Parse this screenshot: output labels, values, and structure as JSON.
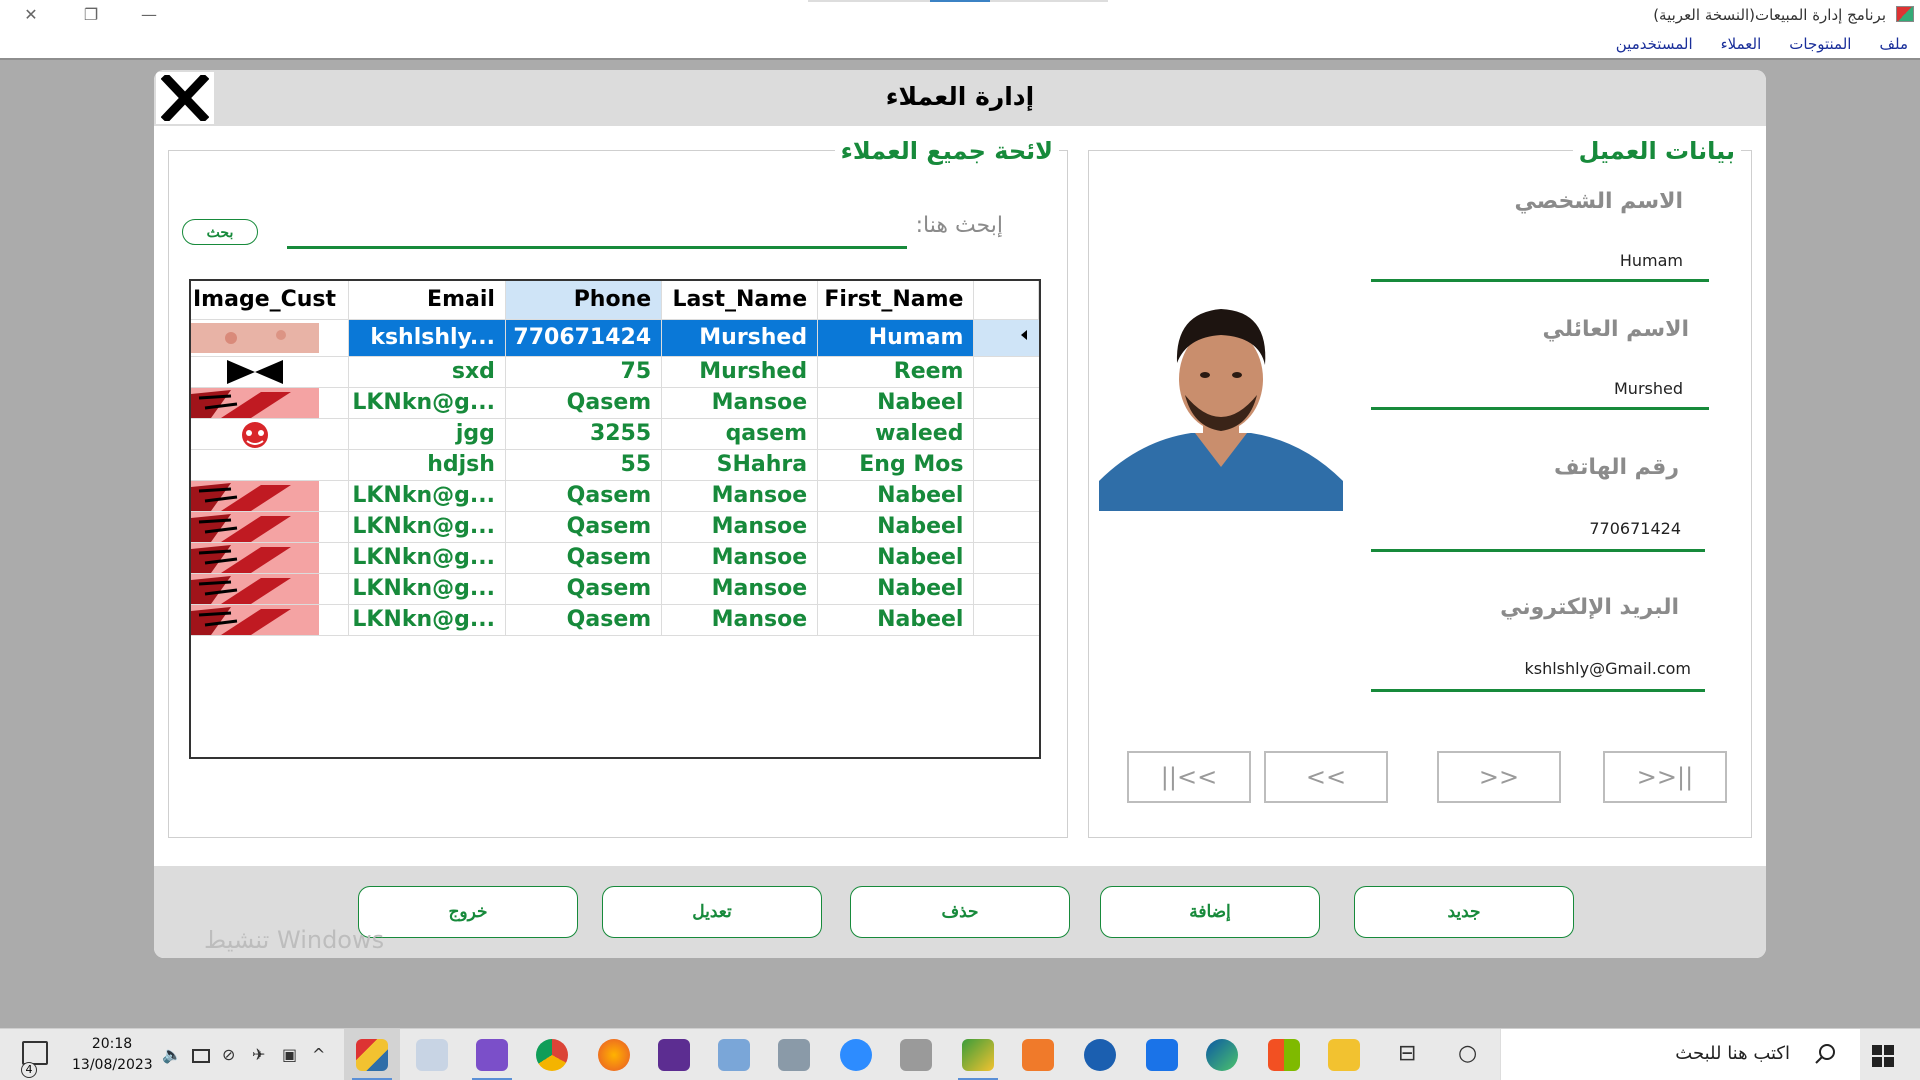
{
  "window": {
    "title": "برنامج إدارة المبيعات(النسخة العربية)",
    "controls": {
      "close": "✕",
      "restore": "❐",
      "minimize": "—"
    }
  },
  "menu": {
    "items": [
      {
        "label": "ملف"
      },
      {
        "label": "المنتوجات"
      },
      {
        "label": "العملاء"
      },
      {
        "label": "المستخدمين"
      }
    ]
  },
  "dialog": {
    "title": "إدارة العملاء",
    "list_group": {
      "title": "لائحة جميع العملاء",
      "search_label": "إبحث هنا:",
      "search_value": "",
      "search_button": "بحث"
    },
    "grid": {
      "columns": [
        "Image_Cust",
        "Email",
        "Phone",
        "Last_Name",
        "First_Name"
      ],
      "sorted_column": "Phone",
      "rows": [
        {
          "image": "skin",
          "email": "kshlshly...",
          "phone": "770671424",
          "last": "Murshed",
          "first": "Humam",
          "selected": true
        },
        {
          "image": "x-mark",
          "email": "sxd",
          "phone": "75",
          "last": "Murshed",
          "first": "Reem",
          "selected": false
        },
        {
          "image": "red-stripes",
          "email": "LKNkn@g...",
          "phone": "Qasem",
          "last": "Mansoe",
          "first": "Nabeel",
          "selected": false
        },
        {
          "image": "red-face",
          "email": "jgg",
          "phone": "3255",
          "last": "qasem",
          "first": "waleed",
          "selected": false
        },
        {
          "image": "blank",
          "email": "hdjsh",
          "phone": "55",
          "last": "SHahra",
          "first": "Eng Mos",
          "selected": false
        },
        {
          "image": "red-stripes",
          "email": "LKNkn@g...",
          "phone": "Qasem",
          "last": "Mansoe",
          "first": "Nabeel",
          "selected": false
        },
        {
          "image": "red-stripes",
          "email": "LKNkn@g...",
          "phone": "Qasem",
          "last": "Mansoe",
          "first": "Nabeel",
          "selected": false
        },
        {
          "image": "red-stripes",
          "email": "LKNkn@g...",
          "phone": "Qasem",
          "last": "Mansoe",
          "first": "Nabeel",
          "selected": false
        },
        {
          "image": "red-stripes",
          "email": "LKNkn@g...",
          "phone": "Qasem",
          "last": "Mansoe",
          "first": "Nabeel",
          "selected": false
        },
        {
          "image": "red-stripes",
          "email": "LKNkn@g...",
          "phone": "Qasem",
          "last": "Mansoe",
          "first": "Nabeel",
          "selected": false
        }
      ]
    },
    "details_group": {
      "title": "بيانات العميل",
      "first_name_label": "الاسم الشخصي",
      "first_name_value": "Humam",
      "last_name_label": "الاسم العائلي",
      "last_name_value": "Murshed",
      "phone_label": "رقم الهاتف",
      "phone_value": "770671424",
      "email_label": "البريد الإلكتروني",
      "email_value": "kshlshly@Gmail.com",
      "nav": {
        "first": ">>||",
        "next": ">>",
        "prev": "<<",
        "last": "||<<"
      }
    },
    "actions": {
      "new": "جديد",
      "add": "إضافة",
      "delete": "حذف",
      "edit": "تعديل",
      "exit": "خروج"
    }
  },
  "watermark": "تنشيط Windows",
  "taskbar": {
    "search_placeholder": "اكتب هنا للبحث",
    "time": "20:18",
    "date": "13/08/2023",
    "notification_count": "4"
  },
  "colors": {
    "accent_green": "#178a3b",
    "selection_blue": "#0a78d7",
    "header_gray": "#dcdcdc",
    "mdi_gray": "#ababab"
  }
}
